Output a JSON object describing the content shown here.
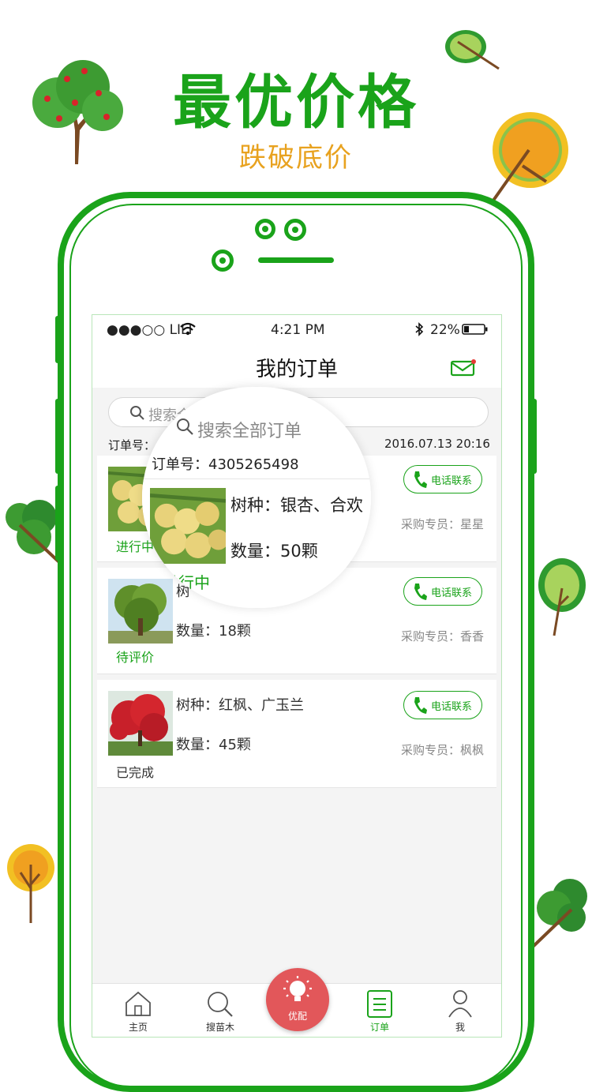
{
  "promo": {
    "headline": "最优价格",
    "subline": "跌破底价"
  },
  "status_bar": {
    "carrier": "●●●○○ LILI",
    "time": "4:21 PM",
    "battery": "22%",
    "icons": [
      "wifi-icon",
      "bluetooth-icon",
      "battery-icon"
    ]
  },
  "nav": {
    "title": "我的订单",
    "icons": [
      "mail-icon"
    ]
  },
  "search": {
    "placeholder": "搜索全部订单",
    "visible_text": "搜索全"
  },
  "order_header": {
    "label": "订单号：4",
    "datetime": "2016.07.13  20:16"
  },
  "orders": [
    {
      "species_text": "树种：银杏、合欢",
      "quantity_text": "数量：50颗",
      "status": "进行中",
      "agent": "采购专员：星星",
      "call_label": "电话联系",
      "image": "ginkgo-fruit-photo"
    },
    {
      "species_text": "树",
      "quantity_text": "数量：18颗",
      "status": "待评价",
      "agent": "采购专员：香香",
      "call_label": "电话联系",
      "image": "green-tree-photo"
    },
    {
      "species_text": "树种：红枫、广玉兰",
      "quantity_text": "数量：45颗",
      "status": "已完成",
      "agent": "采购专员：枫枫",
      "call_label": "电话联系",
      "image": "red-maple-photo"
    }
  ],
  "magnifier": {
    "search_text": "搜索全部订单",
    "order_number": "订单号：4305265498",
    "species": "树种：银杏、合欢",
    "quantity": "数量：50颗",
    "status": "进行中"
  },
  "tabs": [
    {
      "label": "主页",
      "icon": "home-icon"
    },
    {
      "label": "搜苗木",
      "icon": "search-icon"
    },
    {
      "label": "优配",
      "icon": "lightbulb-icon"
    },
    {
      "label": "订单",
      "icon": "order-list-icon"
    },
    {
      "label": "我",
      "icon": "user-icon"
    }
  ],
  "colors": {
    "brand_green": "#1aa31a",
    "promo_orange": "#e8a21f",
    "fab_red": "#e2575a",
    "background": "#f4f4f4"
  }
}
